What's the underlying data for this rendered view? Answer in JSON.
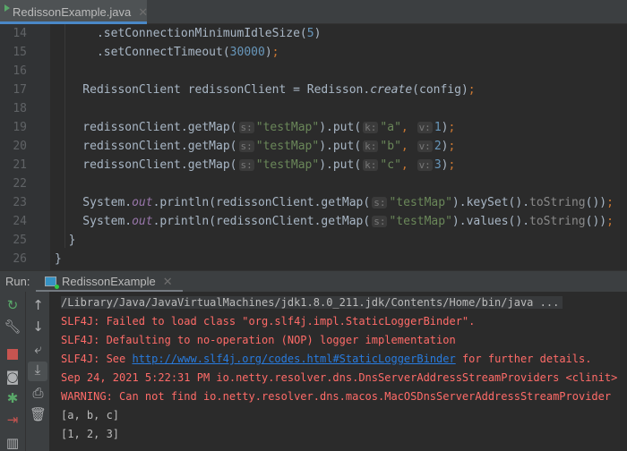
{
  "editor": {
    "tab_label": "RedissonExample.java",
    "lines": [
      {
        "n": "14",
        "t": [
          [
            "p",
            "      .setConnectionMinimumIdleSize("
          ],
          [
            "num",
            "5"
          ],
          [
            "p",
            ")"
          ]
        ]
      },
      {
        "n": "15",
        "t": [
          [
            "p",
            "      .setConnectTimeout("
          ],
          [
            "num",
            "30000"
          ],
          [
            "p",
            ")"
          ],
          [
            "kw",
            ";"
          ]
        ]
      },
      {
        "n": "16",
        "t": []
      },
      {
        "n": "17",
        "t": [
          [
            "p",
            "    RedissonClient redissonClient = Redisson."
          ],
          [
            "st",
            "create"
          ],
          [
            "p",
            "(config)"
          ],
          [
            "kw",
            ";"
          ]
        ]
      },
      {
        "n": "18",
        "t": []
      },
      {
        "n": "19",
        "t": [
          [
            "p",
            "    redissonClient.getMap("
          ],
          [
            "hint",
            "s:"
          ],
          [
            "str",
            "\"testMap\""
          ],
          [
            "p",
            ").put("
          ],
          [
            "hint",
            "k:"
          ],
          [
            "str",
            "\"a\""
          ],
          [
            "kw",
            ", "
          ],
          [
            "hint",
            "v:"
          ],
          [
            "num",
            "1"
          ],
          [
            "p",
            ")"
          ],
          [
            "kw",
            ";"
          ]
        ]
      },
      {
        "n": "20",
        "t": [
          [
            "p",
            "    redissonClient.getMap("
          ],
          [
            "hint",
            "s:"
          ],
          [
            "str",
            "\"testMap\""
          ],
          [
            "p",
            ").put("
          ],
          [
            "hint",
            "k:"
          ],
          [
            "str",
            "\"b\""
          ],
          [
            "kw",
            ", "
          ],
          [
            "hint",
            "v:"
          ],
          [
            "num",
            "2"
          ],
          [
            "p",
            ")"
          ],
          [
            "kw",
            ";"
          ]
        ]
      },
      {
        "n": "21",
        "t": [
          [
            "p",
            "    redissonClient.getMap("
          ],
          [
            "hint",
            "s:"
          ],
          [
            "str",
            "\"testMap\""
          ],
          [
            "p",
            ").put("
          ],
          [
            "hint",
            "k:"
          ],
          [
            "str",
            "\"c\""
          ],
          [
            "kw",
            ", "
          ],
          [
            "hint",
            "v:"
          ],
          [
            "num",
            "3"
          ],
          [
            "p",
            ")"
          ],
          [
            "kw",
            ";"
          ]
        ]
      },
      {
        "n": "22",
        "t": []
      },
      {
        "n": "23",
        "t": [
          [
            "p",
            "    System."
          ],
          [
            "fld",
            "out"
          ],
          [
            "p",
            ".println(redissonClient.getMap("
          ],
          [
            "hint",
            "s:"
          ],
          [
            "str",
            "\"testMap\""
          ],
          [
            "p",
            ").keySet()."
          ],
          [
            "dim",
            "toString"
          ],
          [
            "p",
            "())"
          ],
          [
            "kw",
            ";"
          ]
        ]
      },
      {
        "n": "24",
        "t": [
          [
            "p",
            "    System."
          ],
          [
            "fld",
            "out"
          ],
          [
            "p",
            ".println(redissonClient.getMap("
          ],
          [
            "hint",
            "s:"
          ],
          [
            "str",
            "\"testMap\""
          ],
          [
            "p",
            ").values()."
          ],
          [
            "dim",
            "toString"
          ],
          [
            "p",
            "())"
          ],
          [
            "kw",
            ";"
          ]
        ]
      },
      {
        "n": "25",
        "t": [
          [
            "p",
            "  }"
          ]
        ]
      },
      {
        "n": "26",
        "t": [
          [
            "p",
            "}"
          ]
        ]
      }
    ]
  },
  "run": {
    "label": "Run:",
    "tab_label": "RedissonExample",
    "console": [
      {
        "c": "cmd",
        "t": "/Library/Java/JavaVirtualMachines/jdk1.8.0_211.jdk/Contents/Home/bin/java ..."
      },
      {
        "c": "red",
        "t": "SLF4J: Failed to load class \"org.slf4j.impl.StaticLoggerBinder\"."
      },
      {
        "c": "red",
        "t": "SLF4J: Defaulting to no-operation (NOP) logger implementation"
      },
      {
        "c": "red",
        "t": "SLF4J: See ",
        "link": "http://www.slf4j.org/codes.html#StaticLoggerBinder",
        "after": " for further details."
      },
      {
        "c": "red",
        "t": "Sep 24, 2021 5:22:31 PM io.netty.resolver.dns.DnsServerAddressStreamProviders <clinit>"
      },
      {
        "c": "red",
        "t": "WARNING: Can not find io.netty.resolver.dns.macos.MacOSDnsServerAddressStreamProvider"
      },
      {
        "c": "norm",
        "t": "[a, b, c]"
      },
      {
        "c": "norm",
        "t": "[1, 2, 3]"
      }
    ]
  }
}
